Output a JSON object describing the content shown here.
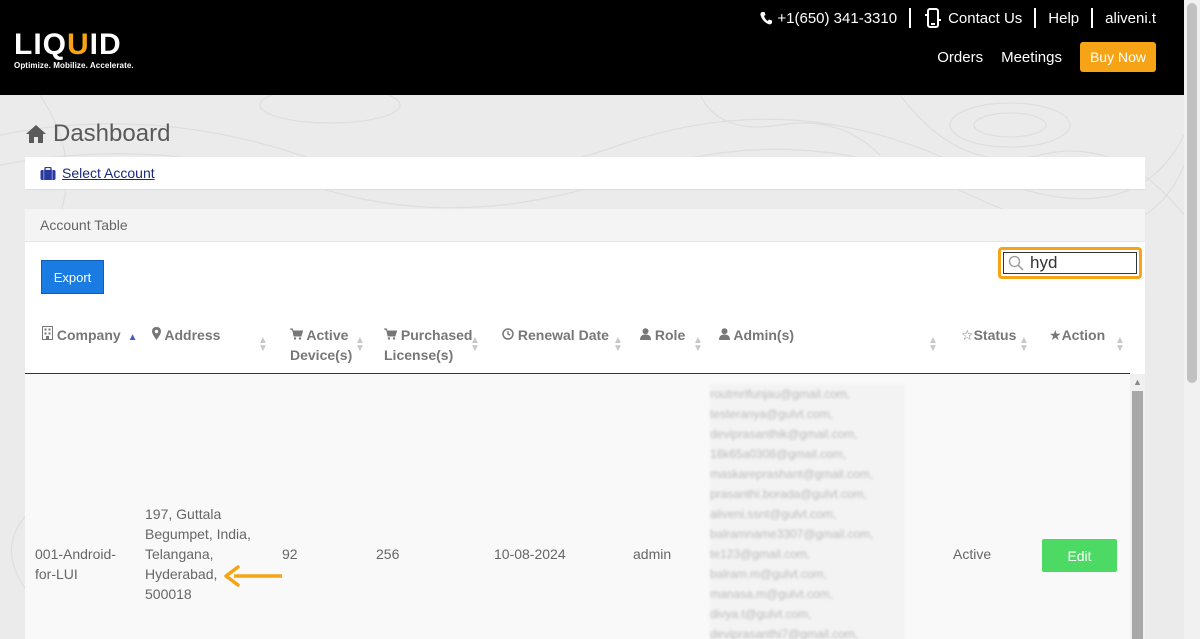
{
  "header": {
    "logo_main_a": "LIQ",
    "logo_main_u": "U",
    "logo_main_b": "ID",
    "logo_tagline": "Optimize. Mobilize. Accelerate.",
    "phone": "+1(650) 341-3310",
    "contact": "Contact Us",
    "help": "Help",
    "user": "aliveni.t",
    "nav_orders": "Orders",
    "nav_meetings": "Meetings",
    "buy_now": "Buy Now"
  },
  "page": {
    "title": "Dashboard",
    "select_account": "Select Account"
  },
  "table_panel": {
    "heading": "Account Table",
    "export_label": "Export",
    "search_value": "hyd",
    "columns": {
      "company": "Company",
      "address": "Address",
      "active_devices_1": "Active",
      "active_devices_2": "Device(s)",
      "purchased_1": "Purchased",
      "purchased_2": "License(s)",
      "renewal": "Renewal Date",
      "role": "Role",
      "admins": "Admin(s)",
      "status": "Status",
      "action": "Action"
    },
    "row": {
      "company_1": "001-Android-",
      "company_2": "for-LUI",
      "address": [
        "197, Guttala",
        "Begumpet, India,",
        "Telangana,",
        "Hyderabad,",
        "500018"
      ],
      "active_devices": "92",
      "purchased": "256",
      "renewal": "10-08-2024",
      "role": "admin",
      "admins": [
        "routmrlfunjau@gmail.com,",
        "testeranya@gulvt.com,",
        "deviprasanthik@gmail.com,",
        "18k65a0308@gmail.com,",
        "maskareprashant@gmail.com,",
        "prasanthi.borada@gulvt.com,",
        "aliveni.ssnt@gulvt.com,",
        "balramname3307@gmail.com,",
        "te123@gmail.com,",
        "balram.m@gulvt.com,",
        "manasa.m@gulvt.com,",
        "divya.t@gulvt.com,",
        "deviprasanthi7@gmail.com,"
      ],
      "status": "Active",
      "edit_label": "Edit"
    }
  },
  "colors": {
    "accent": "#f6a416",
    "export_blue": "#1a7be3",
    "edit_green": "#4cd964"
  }
}
